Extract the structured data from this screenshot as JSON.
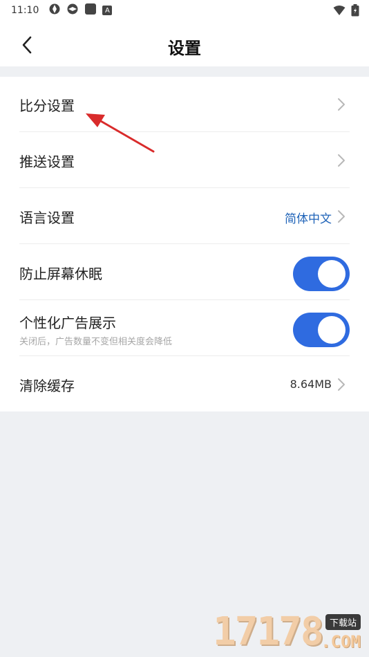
{
  "status_bar": {
    "time": "11:10",
    "a_badge": "A"
  },
  "header": {
    "title": "设置"
  },
  "settings": {
    "score": {
      "label": "比分设置"
    },
    "push": {
      "label": "推送设置"
    },
    "language": {
      "label": "语言设置",
      "value": "简体中文"
    },
    "screen_awake": {
      "label": "防止屏幕休眠",
      "on": true
    },
    "personalized_ads": {
      "label": "个性化广告展示",
      "subtitle": "关闭后，广告数量不变但相关度会降低",
      "on": true
    },
    "cache": {
      "label": "清除缓存",
      "value": "8.64MB"
    }
  },
  "watermark": {
    "digits": "17178",
    "badge": "下载站",
    "com": ".COM"
  },
  "colors": {
    "toggle_on": "#2f6be0",
    "language_value": "#1f63b8",
    "annotation_arrow": "#d92b2b",
    "background": "#eef0f3"
  }
}
